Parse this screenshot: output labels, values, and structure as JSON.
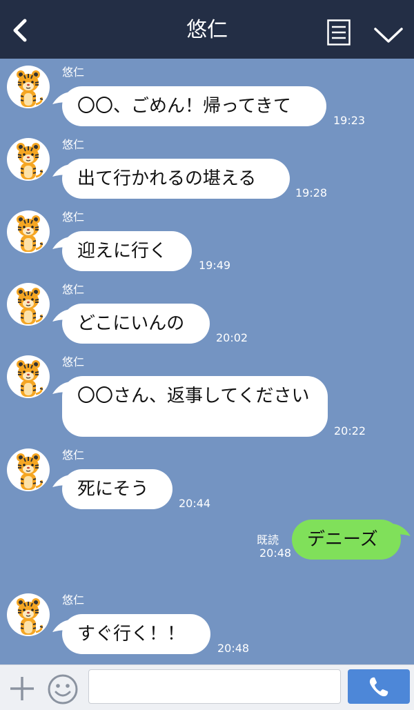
{
  "header": {
    "title": "悠仁",
    "back_icon": "chevron-left-icon",
    "menu_icon": "notes-icon",
    "collapse_icon": "chevron-down-icon"
  },
  "messages": [
    {
      "sender": "悠仁",
      "text": "〇〇、ごめん！帰ってきて",
      "time": "19:23"
    },
    {
      "sender": "悠仁",
      "text": "出て行かれるの堪える",
      "time": "19:28"
    },
    {
      "sender": "悠仁",
      "text": "迎えに行く",
      "time": "19:49"
    },
    {
      "sender": "悠仁",
      "text": "どこにいんの",
      "time": "20:02"
    },
    {
      "sender": "悠仁",
      "text": "〇〇さん、返事してください",
      "time": "20:22"
    },
    {
      "sender": "悠仁",
      "text": "死にそう",
      "time": "20:44"
    },
    {
      "sender": "me",
      "text": "デニーズ",
      "read": "既読",
      "time": "20:48"
    },
    {
      "sender": "悠仁",
      "text": "すぐ行く！！",
      "time": "20:48"
    }
  ],
  "footer": {
    "plus_icon": "plus-icon",
    "emoji_icon": "smiley-icon",
    "input_value": "",
    "call_icon": "phone-icon"
  },
  "colors": {
    "header_bg": "#232e45",
    "chat_bg": "#7494c2",
    "incoming_bubble": "#ffffff",
    "outgoing_bubble": "#80e05a",
    "call_button": "#4d87d8"
  }
}
